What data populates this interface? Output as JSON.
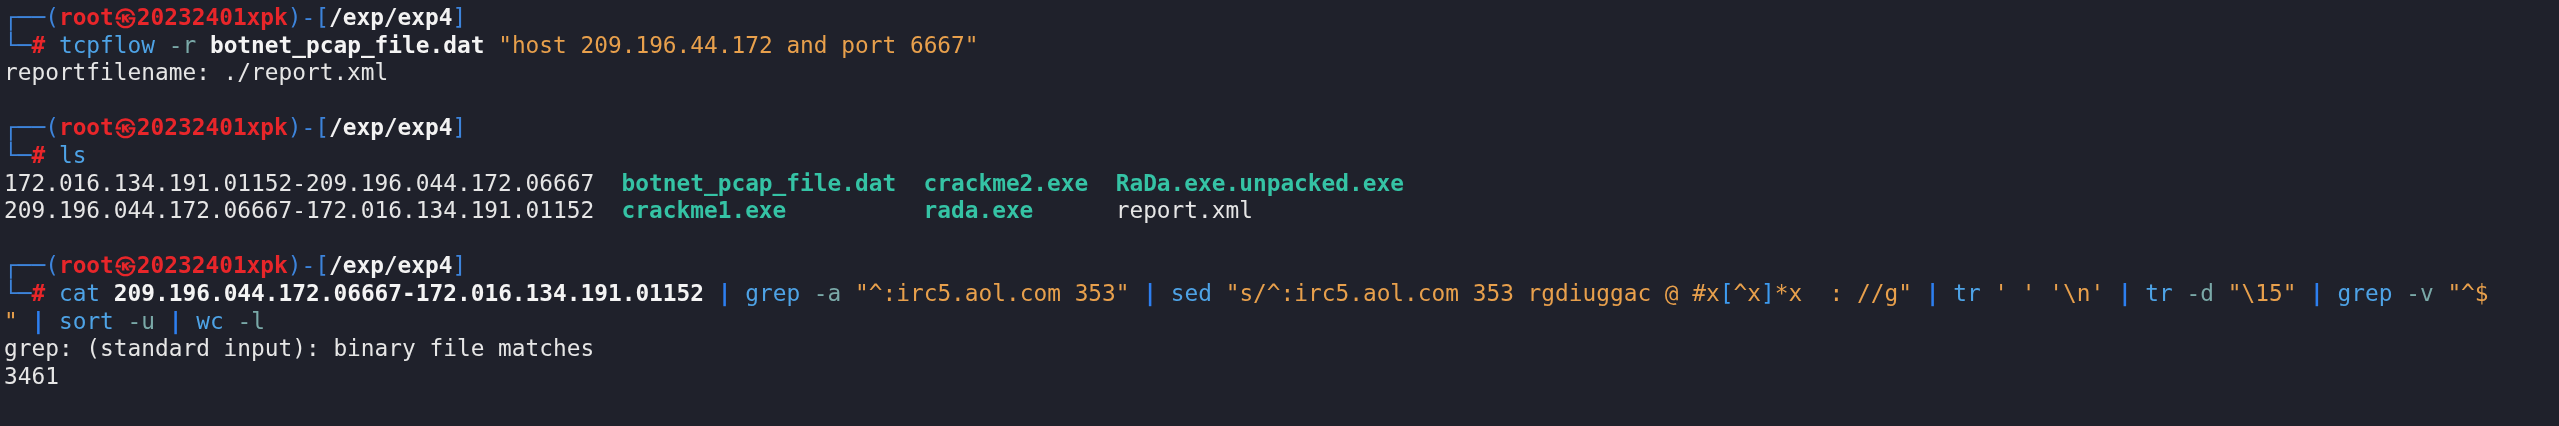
{
  "terminal": {
    "lines": [
      {
        "kind": "prompt",
        "parts": [
          {
            "kind": "frame",
            "text": "┌──("
          },
          {
            "kind": "user",
            "text": "root㉿20232401xpk"
          },
          {
            "kind": "frame",
            "text": ")-["
          },
          {
            "kind": "path",
            "text": "/exp/exp4"
          },
          {
            "kind": "frame",
            "text": "]"
          }
        ]
      },
      {
        "kind": "command",
        "prompt": [
          {
            "kind": "frame",
            "text": "└─"
          },
          {
            "kind": "hash",
            "text": "#"
          }
        ],
        "words": [
          [
            {
              "kind": "cmd",
              "text": "tcpflow"
            }
          ],
          [
            {
              "kind": "option",
              "text": "-r"
            }
          ],
          [
            {
              "kind": "bold",
              "text": "botnet_pcap_file.dat"
            }
          ],
          [
            {
              "kind": "string",
              "text": "\"host 209.196.44.172 and port 6667\""
            }
          ]
        ]
      },
      {
        "kind": "output",
        "text": "reportfilename: ./report.xml"
      },
      {
        "kind": "blank"
      },
      {
        "kind": "prompt",
        "parts": [
          {
            "kind": "frame",
            "text": "┌──("
          },
          {
            "kind": "user",
            "text": "root㉿20232401xpk"
          },
          {
            "kind": "frame",
            "text": ")-["
          },
          {
            "kind": "path",
            "text": "/exp/exp4"
          },
          {
            "kind": "frame",
            "text": "]"
          }
        ]
      },
      {
        "kind": "command",
        "prompt": [
          {
            "kind": "frame",
            "text": "└─"
          },
          {
            "kind": "hash",
            "text": "#"
          }
        ],
        "words": [
          [
            {
              "kind": "cmd",
              "text": "ls"
            }
          ]
        ]
      },
      {
        "kind": "listing",
        "rows": [
          [
            {
              "kind": "plain",
              "text": "172.016.134.191.01152-209.196.044.172.06667"
            },
            {
              "kind": "highlight",
              "text": "botnet_pcap_file.dat"
            },
            {
              "kind": "highlight",
              "text": "crackme2.exe"
            },
            {
              "kind": "highlight",
              "text": "RaDa.exe.unpacked.exe"
            }
          ],
          [
            {
              "kind": "plain",
              "text": "209.196.044.172.06667-172.016.134.191.01152"
            },
            {
              "kind": "highlight",
              "text": "crackme1.exe"
            },
            {
              "kind": "highlight",
              "text": "rada.exe"
            },
            {
              "kind": "plain",
              "text": "report.xml"
            }
          ]
        ]
      },
      {
        "kind": "blank"
      },
      {
        "kind": "prompt",
        "parts": [
          {
            "kind": "frame",
            "text": "┌──("
          },
          {
            "kind": "user",
            "text": "root㉿20232401xpk"
          },
          {
            "kind": "frame",
            "text": ")-["
          },
          {
            "kind": "path",
            "text": "/exp/exp4"
          },
          {
            "kind": "frame",
            "text": "]"
          }
        ]
      },
      {
        "kind": "command",
        "prompt": [
          {
            "kind": "frame",
            "text": "└─"
          },
          {
            "kind": "hash",
            "text": "#"
          }
        ],
        "words": [
          [
            {
              "kind": "cmd",
              "text": "cat"
            }
          ],
          [
            {
              "kind": "bold",
              "text": "209.196.044.172.06667-172.016.134.191.01152"
            }
          ],
          [
            {
              "kind": "pipe",
              "text": "|"
            }
          ],
          [
            {
              "kind": "cmd",
              "text": "grep"
            }
          ],
          [
            {
              "kind": "option",
              "text": "-a"
            }
          ],
          [
            {
              "kind": "string",
              "text": "\"^:irc5.aol.com 353\""
            }
          ],
          [
            {
              "kind": "pipe",
              "text": "|"
            }
          ],
          [
            {
              "kind": "cmd",
              "text": "sed"
            }
          ],
          [
            {
              "kind": "string",
              "text": "\"s/^:irc5.aol.com 353 rgdiuggac @ #x"
            },
            {
              "kind": "bracket",
              "text": "["
            },
            {
              "kind": "string",
              "text": "^x"
            },
            {
              "kind": "bracket",
              "text": "]"
            },
            {
              "kind": "string",
              "text": "*x  : //g\""
            }
          ],
          [
            {
              "kind": "pipe",
              "text": "|"
            }
          ],
          [
            {
              "kind": "cmd",
              "text": "tr"
            }
          ],
          [
            {
              "kind": "string",
              "text": "' ' '\\n'"
            }
          ],
          [
            {
              "kind": "pipe",
              "text": "|"
            }
          ],
          [
            {
              "kind": "cmd",
              "text": "tr"
            }
          ],
          [
            {
              "kind": "option",
              "text": "-d"
            }
          ],
          [
            {
              "kind": "string",
              "text": "\"\\15\""
            }
          ],
          [
            {
              "kind": "pipe",
              "text": "|"
            }
          ],
          [
            {
              "kind": "cmd",
              "text": "grep"
            }
          ],
          [
            {
              "kind": "option",
              "text": "-v"
            }
          ],
          [
            {
              "kind": "string",
              "text": "\"^$"
            }
          ]
        ]
      },
      {
        "kind": "continuation",
        "words": [
          [
            {
              "kind": "string",
              "text": "\""
            }
          ],
          [
            {
              "kind": "pipe",
              "text": "|"
            }
          ],
          [
            {
              "kind": "cmd",
              "text": "sort"
            }
          ],
          [
            {
              "kind": "option",
              "text": "-u"
            }
          ],
          [
            {
              "kind": "pipe",
              "text": "|"
            }
          ],
          [
            {
              "kind": "cmd",
              "text": "wc"
            }
          ],
          [
            {
              "kind": "option",
              "text": "-l"
            }
          ]
        ]
      },
      {
        "kind": "output",
        "text": "grep: (standard input): binary file matches"
      },
      {
        "kind": "output",
        "text": "3461"
      }
    ]
  }
}
